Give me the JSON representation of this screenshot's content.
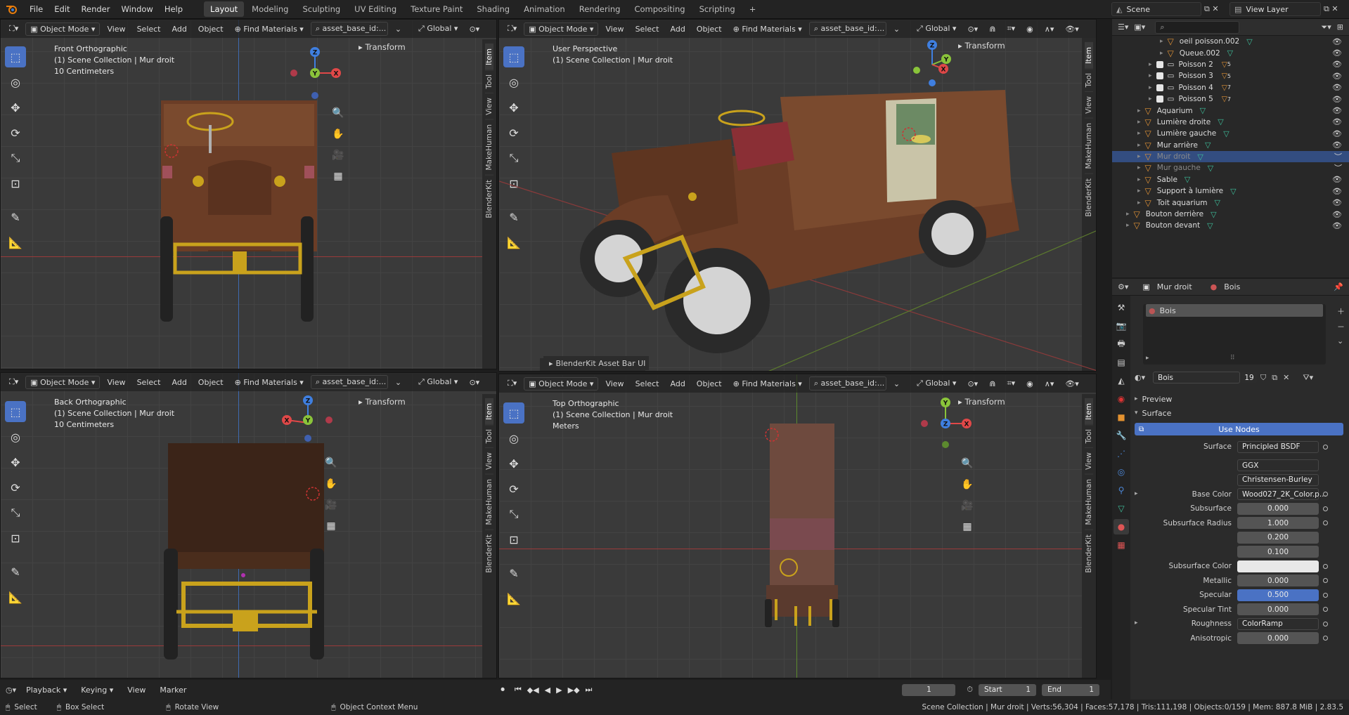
{
  "topbar": {
    "menus": [
      "File",
      "Edit",
      "Render",
      "Window",
      "Help"
    ],
    "workspaces": [
      "Layout",
      "Modeling",
      "Sculpting",
      "UV Editing",
      "Texture Paint",
      "Shading",
      "Animation",
      "Rendering",
      "Compositing",
      "Scripting"
    ],
    "active_workspace": "Layout",
    "add_workspace": "+",
    "scene_label": "Scene",
    "view_layer_label": "View Layer"
  },
  "viewport_header": {
    "mode": "Object Mode",
    "view": "View",
    "select": "Select",
    "add": "Add",
    "object": "Object",
    "find_materials": "Find Materials",
    "asset_search": "asset_base_id:...",
    "orientation": "Global"
  },
  "viewports": {
    "front": {
      "title": "Front Orthographic",
      "collection": "(1) Scene Collection | Mur droit",
      "scale": "10 Centimeters"
    },
    "persp": {
      "title": "User Perspective",
      "collection": "(1) Scene Collection | Mur droit",
      "scale": ""
    },
    "back": {
      "title": "Back Orthographic",
      "collection": "(1) Scene Collection | Mur droit",
      "scale": "10 Centimeters"
    },
    "top": {
      "title": "Top Orthographic",
      "collection": "(1) Scene Collection | Mur droit",
      "scale": "Meters"
    }
  },
  "sidebar": {
    "transform_label": "Transform",
    "tabs": [
      "Item",
      "Tool",
      "View",
      "MakeHuman",
      "BlenderKit"
    ]
  },
  "axes": {
    "x": "X",
    "y": "Y",
    "z": "Z"
  },
  "blenderkit_bar": "BlenderKit Asset Bar UI",
  "outliner": {
    "search_placeholder": "",
    "items": [
      {
        "label": "oeil poisson.002",
        "indent": 4,
        "checkbox": false,
        "selected": false,
        "dim": false,
        "badge": ""
      },
      {
        "label": "Queue.002",
        "indent": 4,
        "checkbox": false,
        "selected": false,
        "dim": false,
        "badge": ""
      },
      {
        "label": "Poisson 2",
        "indent": 3,
        "checkbox": true,
        "selected": false,
        "dim": false,
        "badge": "5"
      },
      {
        "label": "Poisson 3",
        "indent": 3,
        "checkbox": true,
        "selected": false,
        "dim": false,
        "badge": "5"
      },
      {
        "label": "Poisson 4",
        "indent": 3,
        "checkbox": true,
        "selected": false,
        "dim": false,
        "badge": "7"
      },
      {
        "label": "Poisson 5",
        "indent": 3,
        "checkbox": true,
        "selected": false,
        "dim": false,
        "badge": "7"
      },
      {
        "label": "Aquarium",
        "indent": 2,
        "checkbox": false,
        "selected": false,
        "dim": false,
        "badge": ""
      },
      {
        "label": "Lumière droite",
        "indent": 2,
        "checkbox": false,
        "selected": false,
        "dim": false,
        "badge": ""
      },
      {
        "label": "Lumière gauche",
        "indent": 2,
        "checkbox": false,
        "selected": false,
        "dim": false,
        "badge": ""
      },
      {
        "label": "Mur arrière",
        "indent": 2,
        "checkbox": false,
        "selected": false,
        "dim": false,
        "badge": ""
      },
      {
        "label": "Mur droit",
        "indent": 2,
        "checkbox": false,
        "selected": true,
        "dim": true,
        "badge": ""
      },
      {
        "label": "Mur gauche",
        "indent": 2,
        "checkbox": false,
        "selected": false,
        "dim": true,
        "badge": ""
      },
      {
        "label": "Sable",
        "indent": 2,
        "checkbox": false,
        "selected": false,
        "dim": false,
        "badge": ""
      },
      {
        "label": "Support à lumière",
        "indent": 2,
        "checkbox": false,
        "selected": false,
        "dim": false,
        "badge": ""
      },
      {
        "label": "Toit aquarium",
        "indent": 2,
        "checkbox": false,
        "selected": false,
        "dim": false,
        "badge": ""
      },
      {
        "label": "Bouton derrière",
        "indent": 1,
        "checkbox": false,
        "selected": false,
        "dim": false,
        "badge": ""
      },
      {
        "label": "Bouton devant",
        "indent": 1,
        "checkbox": false,
        "selected": false,
        "dim": false,
        "badge": ""
      }
    ]
  },
  "properties": {
    "object_name": "Mur droit",
    "material_name": "Bois",
    "slot_name": "Bois",
    "material_field": "Bois",
    "users": "19",
    "preview": "Preview",
    "surface_section": "Surface",
    "use_nodes": "Use Nodes",
    "rows": [
      {
        "label": "Surface",
        "value": "Principled BSDF",
        "style": "left",
        "dot": true,
        "arrow": false
      },
      {
        "label": "",
        "value": "GGX",
        "style": "left",
        "dot": false,
        "arrow": false
      },
      {
        "label": "",
        "value": "Christensen-Burley",
        "style": "left",
        "dot": false,
        "arrow": false
      },
      {
        "label": "Base Color",
        "value": "Wood027_2K_Color.p...",
        "style": "left",
        "dot": true,
        "arrow": true
      },
      {
        "label": "Subsurface",
        "value": "0.000",
        "style": "num",
        "dot": true,
        "arrow": false
      },
      {
        "label": "Subsurface Radius",
        "value": "1.000",
        "style": "num",
        "dot": true,
        "arrow": false
      },
      {
        "label": "",
        "value": "0.200",
        "style": "num",
        "dot": false,
        "arrow": false
      },
      {
        "label": "",
        "value": "0.100",
        "style": "num",
        "dot": false,
        "arrow": false
      },
      {
        "label": "Subsurface Color",
        "value": "",
        "style": "white",
        "dot": true,
        "arrow": false
      },
      {
        "label": "Metallic",
        "value": "0.000",
        "style": "num",
        "dot": true,
        "arrow": false
      },
      {
        "label": "Specular",
        "value": "0.500",
        "style": "blue",
        "dot": true,
        "arrow": false
      },
      {
        "label": "Specular Tint",
        "value": "0.000",
        "style": "num",
        "dot": true,
        "arrow": false
      },
      {
        "label": "Roughness",
        "value": "ColorRamp",
        "style": "left",
        "dot": true,
        "arrow": true
      },
      {
        "label": "Anisotropic",
        "value": "0.000",
        "style": "num",
        "dot": true,
        "arrow": false
      }
    ]
  },
  "timeline": {
    "playback": "Playback",
    "keying": "Keying",
    "view": "View",
    "marker": "Marker",
    "current_frame": "1",
    "start_label": "Start",
    "start": "1",
    "end_label": "End",
    "end": "1"
  },
  "statusbar": {
    "select": "Select",
    "box_select": "Box Select",
    "rotate_view": "Rotate View",
    "context_menu": "Object Context Menu",
    "stats": "Scene Collection | Mur droit | Verts:56,304 | Faces:57,178 | Tris:111,198 | Objects:0/159 | Mem: 887.8 MiB | 2.83.5"
  },
  "colors": {
    "accent_blue": "#4a72c4",
    "selection": "#334d80",
    "axis_x": "#e04848",
    "axis_y": "#8ac43a",
    "axis_z": "#3f7fe0",
    "wood": "#6b3d26",
    "gold": "#c9a21c"
  }
}
